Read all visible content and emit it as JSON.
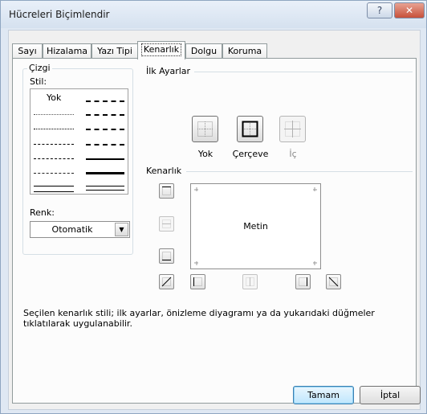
{
  "dialog": {
    "title": "Hücreleri Biçimlendir",
    "help_glyph": "?",
    "close_glyph": "✕"
  },
  "tabs": [
    {
      "label": "Sayı"
    },
    {
      "label": "Hizalama"
    },
    {
      "label": "Yazı Tipi"
    },
    {
      "label": "Kenarlık",
      "selected": true
    },
    {
      "label": "Dolgu"
    },
    {
      "label": "Koruma"
    }
  ],
  "line": {
    "group_title": "Çizgi",
    "style_label": "Stil:",
    "none_label": "Yok",
    "color_label": "Renk:",
    "color_value": "Otomatik",
    "dropdown_glyph": "▼"
  },
  "presets": {
    "title": "İlk Ayarlar",
    "none_label": "Yok",
    "outline_label": "Çerçeve",
    "inside_label": "İç"
  },
  "border": {
    "title": "Kenarlık",
    "preview_text": "Metin"
  },
  "description": "Seçilen kenarlık stili; ilk ayarlar, önizleme diyagramı ya da yukarıdaki düğmeler tıklatılarak uygulanabilir.",
  "buttons": {
    "ok": "Tamam",
    "cancel": "İptal"
  },
  "colors": {
    "dialog_bg": "#f0f0f0",
    "ok_highlight": "#bee6fd",
    "close_red": "#c7503a"
  }
}
